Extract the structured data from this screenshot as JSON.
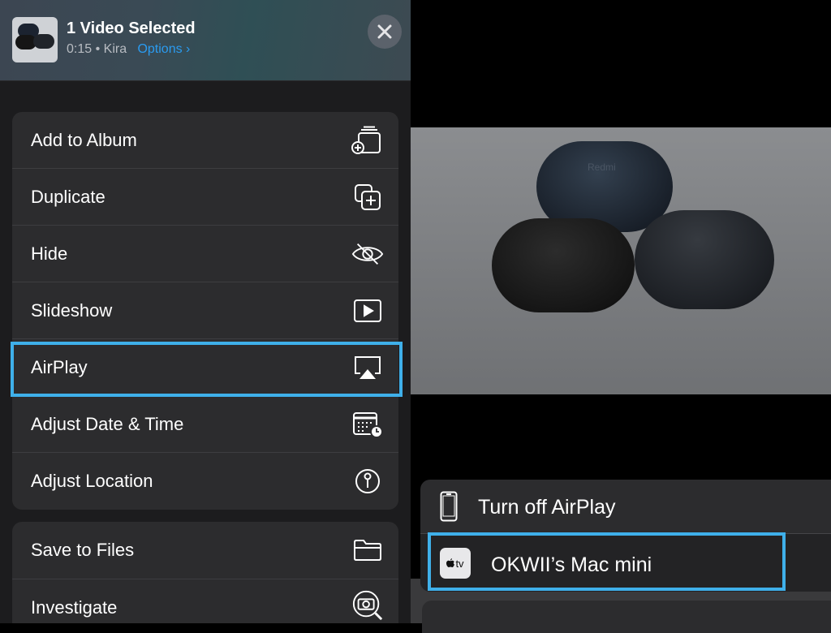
{
  "header": {
    "title": "1 Video Selected",
    "duration": "0:15",
    "separator": "•",
    "owner": "Kira",
    "options_label": "Options",
    "options_chevron": "›"
  },
  "menu_groups": [
    {
      "items": [
        {
          "label": "Add to Album",
          "icon": "add-to-album-icon"
        },
        {
          "label": "Duplicate",
          "icon": "duplicate-icon"
        },
        {
          "label": "Hide",
          "icon": "eye-slash-icon"
        },
        {
          "label": "Slideshow",
          "icon": "play-rectangle-icon"
        },
        {
          "label": "AirPlay",
          "icon": "airplay-icon"
        },
        {
          "label": "Adjust Date & Time",
          "icon": "calendar-clock-icon"
        },
        {
          "label": "Adjust Location",
          "icon": "location-pin-icon"
        }
      ]
    },
    {
      "items": [
        {
          "label": "Save to Files",
          "icon": "folder-icon"
        },
        {
          "label": "Investigate",
          "icon": "visual-lookup-icon"
        }
      ]
    }
  ],
  "preview": {
    "product_logo": "Redmi"
  },
  "airplay_menu": {
    "items": [
      {
        "label": "Turn off AirPlay",
        "icon": "iphone-icon"
      },
      {
        "label": "OKWII’s Mac mini",
        "icon": "apple-tv-icon",
        "icon_text": "tv"
      }
    ]
  },
  "colors": {
    "highlight": "#3fb0ea",
    "link": "#2a9bf0",
    "sheet_bg": "#1c1c1e",
    "group_bg": "#2c2c2e"
  }
}
